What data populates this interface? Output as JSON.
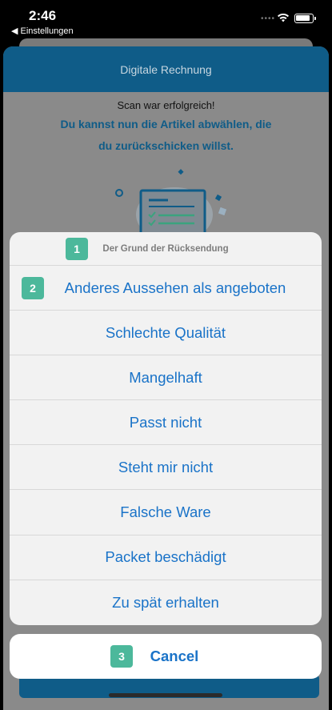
{
  "status_bar": {
    "time": "2:46",
    "back_app": "◀ Einstellungen",
    "dots": "••••"
  },
  "header": {
    "title": "Digitale Rechnung"
  },
  "content": {
    "scan_message": "Scan war erfolgreich!",
    "info_line1": "Du kannst nun die Artikel abwählen, die",
    "info_line2": "du zurückschicken willst."
  },
  "action_sheet": {
    "title": "Der Grund der Rücksendung",
    "title_badge": "1",
    "first_item_badge": "2",
    "items": [
      "Anderes Aussehen als angeboten",
      "Schlechte Qualität",
      "Mangelhaft",
      "Passt nicht",
      "Steht mir nicht",
      "Falsche Ware",
      "Packet beschädigt",
      "Zu spät erhalten"
    ],
    "cancel_label": "Cancel",
    "cancel_badge": "3"
  },
  "colors": {
    "brand_blue": "#0f5c88",
    "action_text": "#1a73c8",
    "badge": "#4cb89b"
  }
}
